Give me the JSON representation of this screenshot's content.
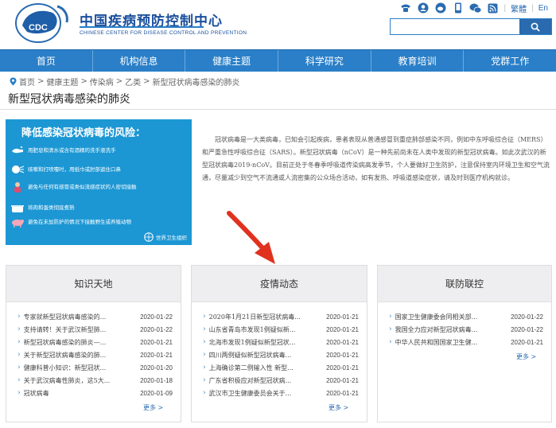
{
  "header": {
    "site_title": "中国疾病预防控制中心",
    "site_subtitle": "CHINESE CENTER FOR DISEASE CONTROL AND PREVENTION",
    "logo_text": "CDC",
    "lang_traditional": "繁體",
    "lang_en": "En",
    "search_placeholder": ""
  },
  "nav": [
    "首页",
    "机构信息",
    "健康主题",
    "科学研究",
    "教育培训",
    "党群工作"
  ],
  "breadcrumb": [
    "首页",
    "健康主题",
    "传染病",
    "乙类",
    "新型冠状病毒感染的肺炎"
  ],
  "page_title": "新型冠状病毒感染的肺炎",
  "poster": {
    "title": "降低感染冠状病毒的风险：",
    "rows": [
      "用肥皂和清水或含有酒精的洗手液洗手",
      "咳嗽和打喷嚏时，用纸巾或肘部遮住口鼻",
      "避免与任何有感冒或类似流感症状的人密切接触",
      "将肉和蛋类彻底煮熟",
      "避免在未加防护的情况下接触野生或养殖动物"
    ],
    "footer": "世界卫生组织"
  },
  "body_text": "冠状病毒是一大类病毒，已知会引起疾病，患者表现从普通感冒到重症肺部感染不同，例如中东呼吸综合征（MERS）和严重急性呼吸综合征（SARS）。新型冠状病毒（nCoV）是一种先前尚未在人类中发现的新型冠状病毒。如此次武汉的新型冠状病毒2019-nCoV。目前正处于冬春季呼吸道传染病高发季节，个人要做好卫生防护，注意保持室内环境卫生和空气流通，尽量减少到空气不流通或人流密集的公众场合活动，如有发热、呼吸道感染症状，请及时到医疗机构就诊。",
  "panels": [
    {
      "title": "知识天地",
      "items": [
        {
          "t": "专家就新型冠状病毒感染的...",
          "d": "2020-01-22"
        },
        {
          "t": "支持请转！关于武汉新型肺...",
          "d": "2020-01-22"
        },
        {
          "t": "新型冠状病毒感染的肺炎—...",
          "d": "2020-01-21"
        },
        {
          "t": "关于新型冠状病毒感染的肺...",
          "d": "2020-01-21"
        },
        {
          "t": "健康科普小知识：新型冠状...",
          "d": "2020-01-20"
        },
        {
          "t": "关于武汉病毒性肺炎，这5大...",
          "d": "2020-01-18"
        },
        {
          "t": "冠状病毒",
          "d": "2020-01-09"
        }
      ],
      "more": "更多 >"
    },
    {
      "title": "疫情动态",
      "items": [
        {
          "t": "2020年1月21日新型冠状病毒...",
          "d": "2020-01-21"
        },
        {
          "t": "山东省青岛市发现1例疑似新...",
          "d": "2020-01-21"
        },
        {
          "t": "北海市发现1例疑似新型冠状...",
          "d": "2020-01-21"
        },
        {
          "t": "四川两例疑似新型冠状病毒...",
          "d": "2020-01-21"
        },
        {
          "t": "上海确诊第二例输入性 新型...",
          "d": "2020-01-21"
        },
        {
          "t": "广东省积极应对新型冠状病...",
          "d": "2020-01-21"
        },
        {
          "t": "武汉市卫生健康委员会关于...",
          "d": "2020-01-21"
        }
      ],
      "more": "更多 >"
    },
    {
      "title": "联防联控",
      "items": [
        {
          "t": "国家卫生健康委会同相关部...",
          "d": "2020-01-22"
        },
        {
          "t": "我国全力应对新型冠状病毒...",
          "d": "2020-01-22"
        },
        {
          "t": "中华人民共和国国家卫生健...",
          "d": "2020-01-21"
        }
      ],
      "more": "更多 >"
    }
  ],
  "colors": {
    "brand_blue": "#2a7fc8",
    "nav_blue": "#2a7fc8",
    "arrow_red": "#e0321e",
    "poster_blue": "#1c97d4"
  }
}
